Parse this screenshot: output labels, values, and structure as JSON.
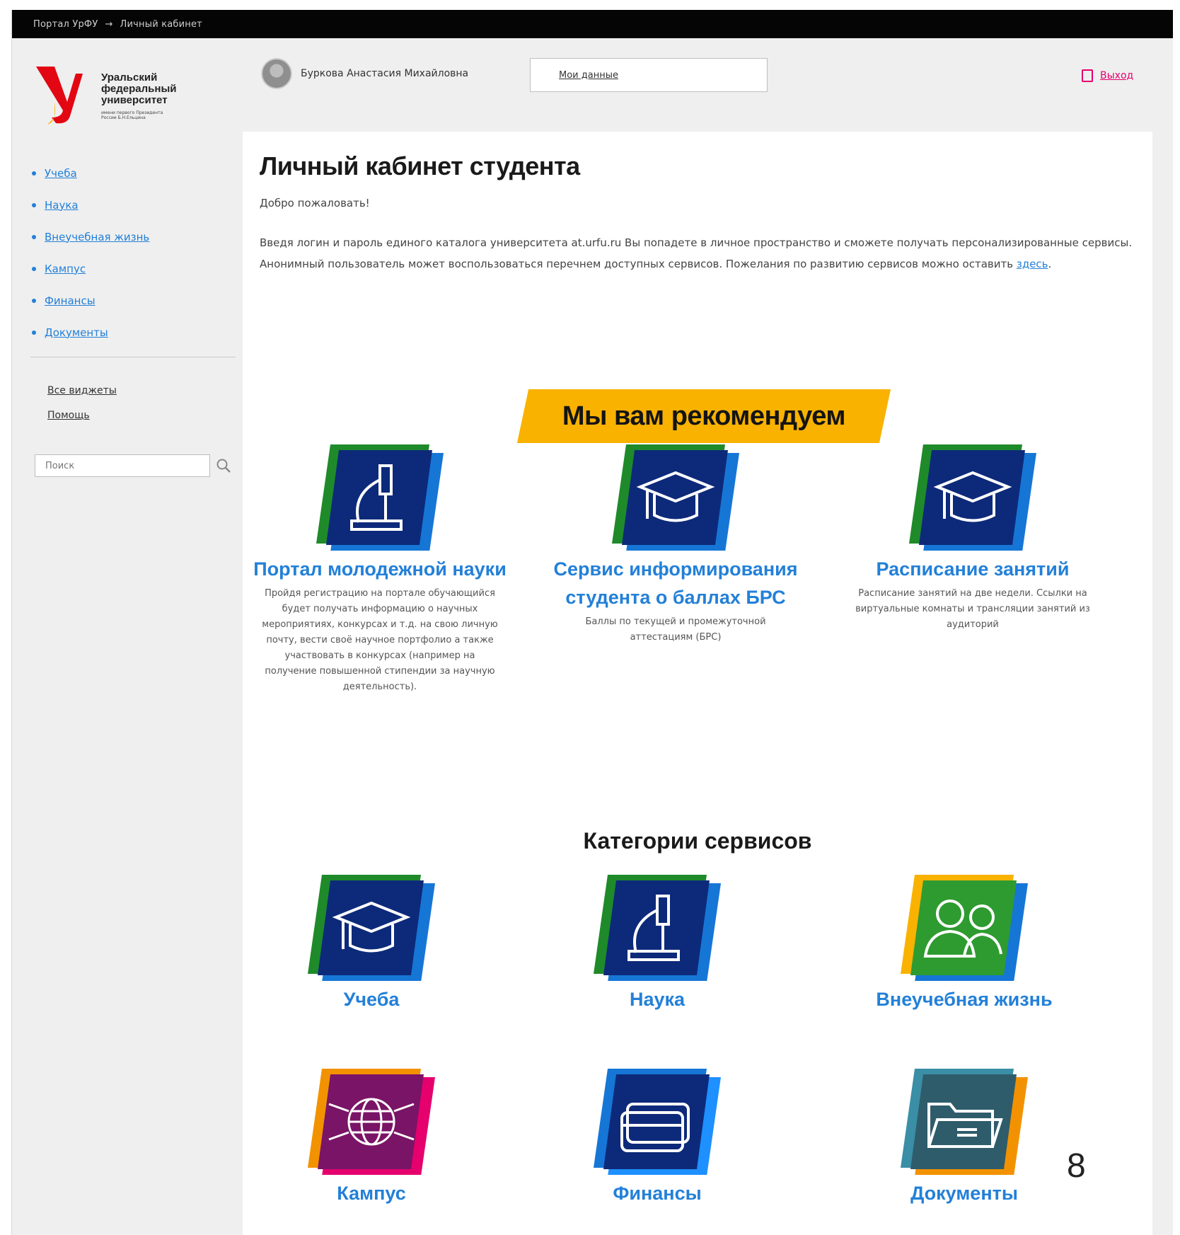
{
  "breadcrumb": {
    "home": "Портал УрФУ",
    "arrow": "→",
    "current": "Личный кабинет"
  },
  "logo": {
    "line1": "Уральский",
    "line2": "федеральный",
    "line3": "университет",
    "small": "имени первого Президента России Б.Н.Ельцина"
  },
  "user": {
    "name": "Буркова Анастасия Михайловна",
    "my_data": "Мои данные",
    "logout": "Выход"
  },
  "sidebar": {
    "items": [
      {
        "label": "Учеба"
      },
      {
        "label": "Наука"
      },
      {
        "label": "Внеучебная жизнь"
      },
      {
        "label": "Кампус"
      },
      {
        "label": "Финансы"
      },
      {
        "label": "Документы"
      }
    ],
    "all_widgets": "Все виджеты",
    "help": "Помощь",
    "search_placeholder": "Поиск"
  },
  "main": {
    "title": "Личный кабинет студента",
    "welcome": "Добро пожаловать!",
    "intro": "Введя логин и пароль единого каталога университета at.urfu.ru Вы попадете в личное пространство и сможете получать персонализированные сервисы. Анонимный пользователь может воспользоваться перечнем доступных сервисов. Пожелания по развитию сервисов можно оставить ",
    "intro_link": "здесь",
    "intro_end": ".",
    "recommend": "Мы вам рекомендуем",
    "recommended": [
      {
        "title": "Портал молодежной науки",
        "desc": "Пройдя регистрацию на портале обучающийся будет получать информацию о научных мероприятиях, конкурсах и т.д. на свою личную почту, вести своё научное портфолио а также участвовать в конкурсах (например на получение повышенной стипендии за научную деятельность)."
      },
      {
        "title": "Сервис информирования студента о баллах БРС",
        "desc": "Баллы по текущей и промежуточной аттестациям (БРС)"
      },
      {
        "title": "Расписание занятий",
        "desc": "Расписание занятий на две недели. Ссылки на виртуальные комнаты и трансляции занятий из аудиторий"
      }
    ],
    "categories_title": "Категории сервисов",
    "categories": [
      {
        "title": "Учеба"
      },
      {
        "title": "Наука"
      },
      {
        "title": "Внеучебная жизнь"
      },
      {
        "title": "Кампус"
      },
      {
        "title": "Финансы"
      },
      {
        "title": "Документы"
      }
    ]
  },
  "slide_number": "8",
  "colors": {
    "link": "#2380d8",
    "accent": "#f9b200",
    "logout": "#e5006e",
    "navy": "#0d2a7a",
    "green": "#1f8a2a"
  }
}
